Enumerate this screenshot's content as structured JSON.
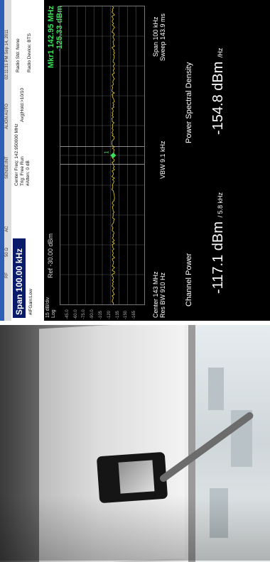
{
  "analyzer": {
    "menu": [
      "RF",
      "50 Ω",
      "AC",
      "SENSE:INT",
      "ALIGN AUTO",
      "02:11:31 PM Sep 14, 2011"
    ],
    "span": "Span 100.00 kHz",
    "center_freq_line": "Center Freq: 142.950000 MHz",
    "trig_line": "Trig: Free Run",
    "atten_line": "#Atten: 0 dB",
    "avg_line": "Avg|Hold:>10/10",
    "ifgain": "#IFGain:Low",
    "radio_std": "Radio Std: None",
    "radio_device": "Radio Device: BTS",
    "scale_div": "15 dB/div",
    "log": "Log",
    "ref": "Ref -30.00 dBm",
    "y_ticks": [
      "-45.0",
      "-60.0",
      "-75.0",
      "-90.0",
      "-105",
      "-120",
      "-135",
      "-150",
      "-165"
    ],
    "marker_line1": "Mkr1  142.95 MHz",
    "marker_line2": "-125.33 dBm",
    "marker_id": "1",
    "center_label": "Center  143 MHz",
    "res_bw": "Res BW  910 Hz",
    "vbw": "VBW  9.1 kHz",
    "span_label": "Span 100 kHz",
    "sweep": "Sweep  143.9 ms",
    "channel_power_label": "Channel Power",
    "channel_power_value": "-117.1 dBm",
    "channel_power_bw": "/ 5.8 kHz",
    "psd_label": "Power Spectral Density",
    "psd_value": "-154.8 dBm",
    "psd_unit": "/Hz",
    "accent_color": "#39e05a",
    "trace_color": "#e8d23a"
  }
}
